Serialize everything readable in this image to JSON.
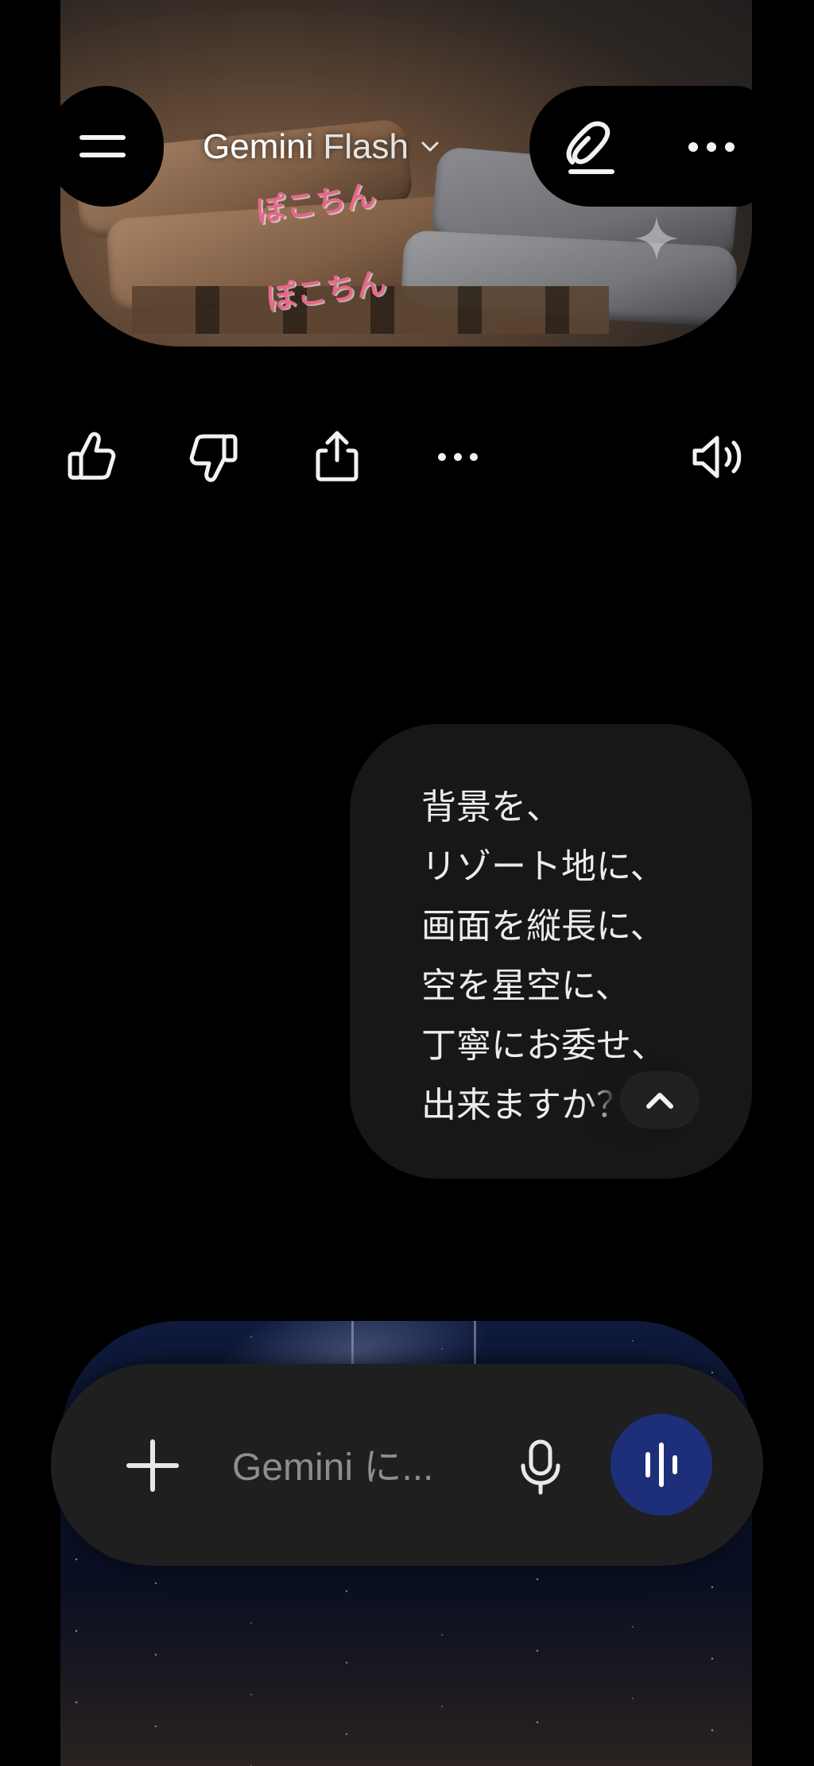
{
  "header": {
    "app_name": "Gemini",
    "model_name": "Flash",
    "menu_icon": "hamburger-menu-icon",
    "new_chat_icon": "edit-pencil-icon",
    "more_icon": "more-horizontal-icon",
    "model_dropdown_icon": "chevron-down-icon"
  },
  "previous_image": {
    "sticker_texts": [
      "ぽこちん",
      "ぽこちん"
    ]
  },
  "response_actions": [
    {
      "name": "like",
      "icon": "thumbs-up-icon"
    },
    {
      "name": "dislike",
      "icon": "thumbs-down-icon"
    },
    {
      "name": "share",
      "icon": "share-icon"
    },
    {
      "name": "more",
      "icon": "more-horizontal-icon"
    },
    {
      "name": "read-aloud",
      "icon": "speaker-icon"
    }
  ],
  "user_message": {
    "text": "背景を、\nリゾート地に、\n画面を縦長に、\n空を星空に、\n丁寧にお委せ、\n出来ますか？",
    "collapse_icon": "chevron-up-icon"
  },
  "composer": {
    "placeholder": "Gemini に...",
    "add_icon": "plus-icon",
    "mic_icon": "microphone-icon",
    "live_icon": "audio-wave-icon",
    "live_button_color": "#1d2f78"
  },
  "colors": {
    "background": "#000000",
    "bubble": "#171717",
    "composer": "#1f1f1f",
    "text": "#ececec"
  }
}
